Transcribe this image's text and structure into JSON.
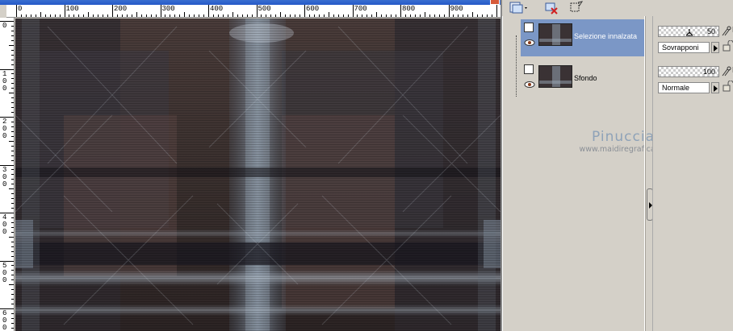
{
  "ruler": {
    "h_labels": [
      "0",
      "100",
      "200",
      "300",
      "400",
      "500",
      "600",
      "700",
      "800",
      "900"
    ],
    "v_labels": [
      "0",
      "100",
      "200",
      "300",
      "400",
      "500",
      "600"
    ]
  },
  "toolbar": {
    "new_layer_icon": "new-layer-icon",
    "delete_layer_icon": "delete-layer-icon",
    "mask_icon": "mask-icon"
  },
  "layers": [
    {
      "name": "Selezione innalzata",
      "selected": true
    },
    {
      "name": "Sfondo",
      "selected": false
    }
  ],
  "watermark": {
    "name": "Pinuccia",
    "url": "www.maidiregrafica.eu"
  },
  "properties": [
    {
      "opacity": "50",
      "blend_mode": "Sovrapponi"
    },
    {
      "opacity": "100",
      "blend_mode": "Normale"
    }
  ],
  "colors": {
    "selected_layer": "#7b97c6",
    "panel_bg": "#d4d0c8",
    "watermark_name": "#8ea2b8"
  }
}
